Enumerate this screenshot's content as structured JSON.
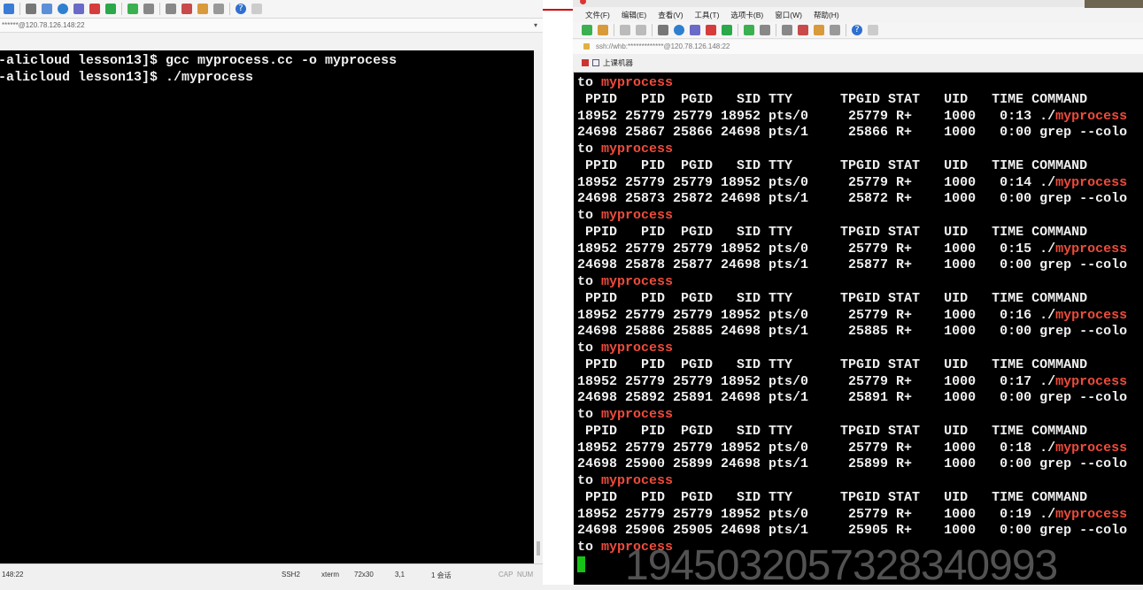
{
  "left_window": {
    "address": "******@120.78.126.148:22",
    "terminal_lines": [
      "-alicloud lesson13]$ gcc myprocess.cc -o myprocess",
      "-alicloud lesson13]$ ./myprocess"
    ],
    "status": {
      "host": "148:22",
      "protocol": "SSH2",
      "term": "xterm",
      "size": "72x30",
      "pos": "3,1",
      "sessions": "1 会话",
      "caps": "CAP",
      "num": "NUM"
    }
  },
  "right_window": {
    "menu": [
      "文件(F)",
      "编辑(E)",
      "查看(V)",
      "工具(T)",
      "选项卡(B)",
      "窗口(W)",
      "帮助(H)"
    ],
    "address": "ssh://whb:*************@120.78.126.148:22",
    "tab_label": "上课机器",
    "header": " PPID   PID  PGID   SID TTY      TPGID STAT   UID   TIME COMMAND",
    "to_prefix": "to ",
    "proc_name": "myprocess",
    "blocks": [
      {
        "row1": "18952 25779 25779 18952 pts/0     25779 R+    1000   0:13 ./",
        "row2": "24698 25867 25866 24698 pts/1     25866 R+    1000   0:00 grep --colo"
      },
      {
        "row1": "18952 25779 25779 18952 pts/0     25779 R+    1000   0:14 ./",
        "row2": "24698 25873 25872 24698 pts/1     25872 R+    1000   0:00 grep --colo"
      },
      {
        "row1": "18952 25779 25779 18952 pts/0     25779 R+    1000   0:15 ./",
        "row2": "24698 25878 25877 24698 pts/1     25877 R+    1000   0:00 grep --colo"
      },
      {
        "row1": "18952 25779 25779 18952 pts/0     25779 R+    1000   0:16 ./",
        "row2": "24698 25886 25885 24698 pts/1     25885 R+    1000   0:00 grep --colo"
      },
      {
        "row1": "18952 25779 25779 18952 pts/0     25779 R+    1000   0:17 ./",
        "row2": "24698 25892 25891 24698 pts/1     25891 R+    1000   0:00 grep --colo"
      },
      {
        "row1": "18952 25779 25779 18952 pts/0     25779 R+    1000   0:18 ./",
        "row2": "24698 25900 25899 24698 pts/1     25899 R+    1000   0:00 grep --colo"
      },
      {
        "row1": "18952 25779 25779 18952 pts/0     25779 R+    1000   0:19 ./",
        "row2": "24698 25906 25905 24698 pts/1     25905 R+    1000   0:00 grep --colo"
      }
    ]
  },
  "watermark": "1945032057328340993",
  "colors": {
    "highlight": "#ef4b3b",
    "cursor": "#16c216",
    "terminal_bg": "#000000"
  }
}
